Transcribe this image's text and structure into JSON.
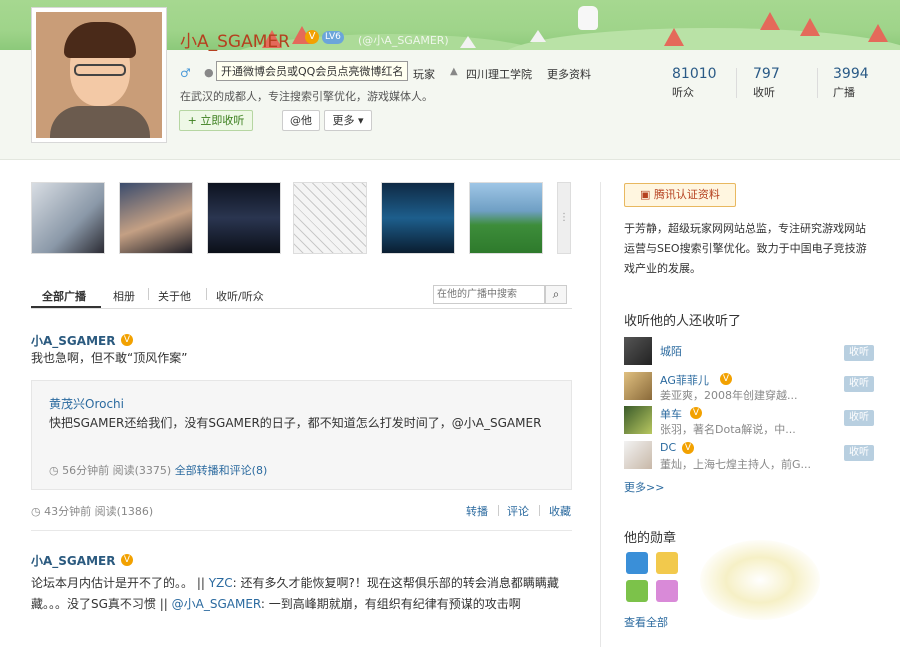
{
  "profile": {
    "name": "小A_SGAMER",
    "level_badge": "LV6",
    "handle": "(@小A_SGAMER)",
    "gender_symbol": "♂",
    "tooltip": "开通微博会员或QQ会员点亮微博红名",
    "location_tail": "玩家",
    "school": "四川理工学院",
    "more_info": "更多资料",
    "bio": "在武汉的成都人，专注搜索引擎优化，游戏媒体人。",
    "follow_button": "+ 立即收听",
    "mention_button": "@他",
    "more_button": "更多 ▾"
  },
  "stats": [
    {
      "num": "81010",
      "label": "听众"
    },
    {
      "num": "797",
      "label": "收听"
    },
    {
      "num": "3994",
      "label": "广播"
    }
  ],
  "tabs": {
    "all": "全部广播",
    "album": "相册",
    "about": "关于他",
    "follows": "收听/听众",
    "search_placeholder": "在他的广播中搜索"
  },
  "posts": [
    {
      "author": "小A_SGAMER",
      "text": "我也急啊，但不敢“顶风作案”",
      "quote_author": "黄茂兴Orochi",
      "quote_text": "快把SGAMER还给我们，没有SGAMER的日子，都不知道怎么打发时间了，@小A_SGAMER",
      "quote_meta_time": "56分钟前 阅读(3375)",
      "quote_meta_link": "全部转播和评论(8)",
      "meta": "43分钟前 阅读(1386)",
      "actions": [
        "转播",
        "评论",
        "收藏"
      ]
    },
    {
      "author": "小A_SGAMER",
      "text_prefix": "论坛本月内估计是开不了的。。 || ",
      "text_link1": "YZC",
      "text_mid": ": 还有多久才能恢复啊?！现在这帮俱乐部的转会消息都瞒瞒藏藏。。。没了SG真不习惯 || ",
      "text_link2": "@小A_SGAMER",
      "text_suffix": ": 一到高峰期就崩，有组织有纪律有预谋的攻击啊"
    }
  ],
  "sidebar": {
    "verify_button": "腾讯认证资料",
    "verify_text": "于芳静，超级玩家网网站总监，专注研究游戏网站运营与SEO搜索引擎优化。致力于中国电子竞技游戏产业的发展。",
    "followers_title": "收听他的人还收听了",
    "recommendations": [
      {
        "name": "城陌",
        "desc": "",
        "button": "收听"
      },
      {
        "name": "AG菲菲儿",
        "desc": "姜亚爽，2008年创建穿越...",
        "button": "收听"
      },
      {
        "name": "单车",
        "desc": "张羽，著名Dota解说，中...",
        "button": "收听"
      },
      {
        "name": "DC",
        "desc": "董灿，上海七煌主持人，前G...",
        "button": "收听"
      }
    ],
    "more_link": "更多>>",
    "medals_title": "他的勋章",
    "view_all": "查看全部"
  },
  "colors": {
    "name_red": "#b5401f",
    "link_blue": "#2b6a9f",
    "banner_green": "#9fd48a",
    "verify_orange": "#f2a100"
  }
}
